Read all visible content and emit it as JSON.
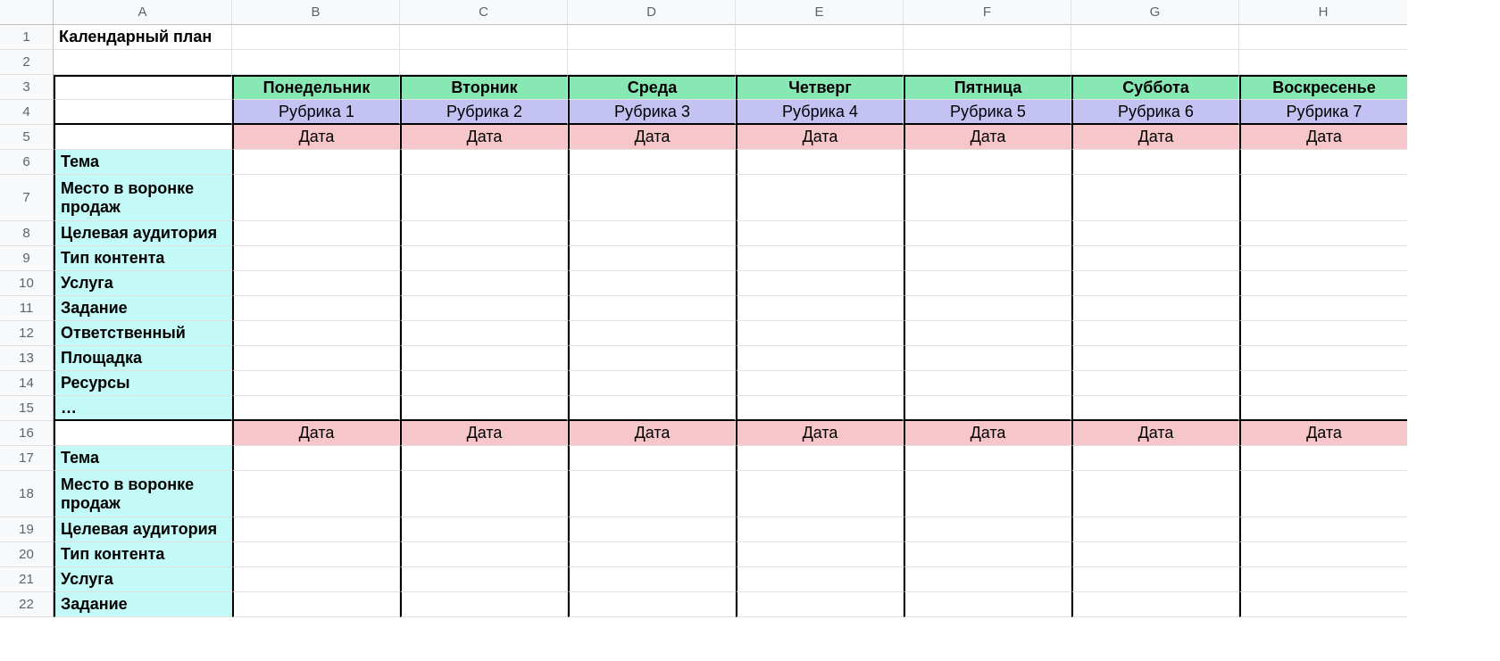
{
  "columns": [
    "A",
    "B",
    "C",
    "D",
    "E",
    "F",
    "G",
    "H"
  ],
  "rowNumbers": [
    1,
    2,
    3,
    4,
    5,
    6,
    7,
    8,
    9,
    10,
    11,
    12,
    13,
    14,
    15,
    16,
    17,
    18,
    19,
    20,
    21,
    22
  ],
  "title": "Календарный план",
  "days": [
    "Понедельник",
    "Вторник",
    "Среда",
    "Четверг",
    "Пятница",
    "Суббота",
    "Воскресенье"
  ],
  "rubrics": [
    "Рубрика 1",
    "Рубрика 2",
    "Рубрика 3",
    "Рубрика 4",
    "Рубрика 5",
    "Рубрика 6",
    "Рубрика 7"
  ],
  "dateLabel": "Дата",
  "week1": {
    "labels": [
      "Тема",
      "Место в воронке продаж",
      "Целевая аудитория",
      "Тип контента",
      "Услуга",
      "Задание",
      "Ответственный",
      "Площадка",
      "Ресурсы",
      "…"
    ]
  },
  "week2": {
    "labels": [
      "Тема",
      "Место в воронке продаж",
      "Целевая аудитория",
      "Тип контента",
      "Услуга",
      "Задание"
    ]
  }
}
